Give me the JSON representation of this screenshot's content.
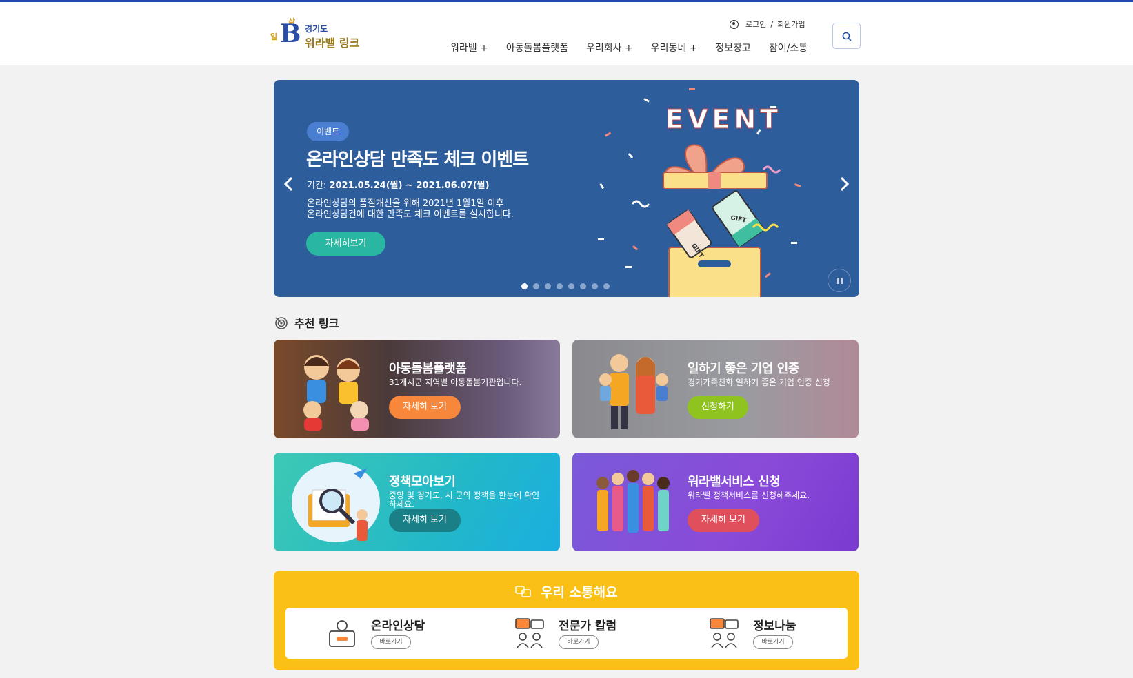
{
  "header": {
    "logo": {
      "region": "경기도",
      "name": "워라밸 링크",
      "mark_top": "삶",
      "mark_side": "일"
    },
    "util": {
      "login": "로그인",
      "separator": "/",
      "signup": "회원가입"
    },
    "nav": [
      "워라밸 +",
      "아동돌봄플랫폼",
      "우리회사 +",
      "우리동네 +",
      "정보창고",
      "참여/소통"
    ]
  },
  "banner": {
    "tag": "이벤트",
    "title": "온라인상담 만족도 체크 이벤트",
    "period_label": "기간:",
    "period": "2021.05.24(월) ~ 2021.06.07(월)",
    "desc_line1": "온라인상담의 품질개선을 위해 2021년 1월1일 이후",
    "desc_line2": "온라인상담건에 대한 만족도 체크 이벤트를 실시합니다.",
    "button": "자세히보기",
    "event_text": "EVENT",
    "gift": "GIFT",
    "slide_count": 8,
    "active_slide": 1
  },
  "recommend": {
    "title": "추천 링크",
    "cards": [
      {
        "title": "아동돌봄플랫폼",
        "desc": "31개시군 지역별 아동돌봄기관입니다.",
        "button": "자세히 보기",
        "button_color": "#f7873a"
      },
      {
        "title": "일하기 좋은 기업 인증",
        "desc": "경기가족친화 일하기 좋은 기업 인증 신청",
        "button": "신청하기",
        "button_color": "#8fc31f"
      },
      {
        "title": "정책모아보기",
        "desc": "중앙 및 경기도, 시 군의 정책을 한눈에 확인하세요.",
        "button": "자세히 보기",
        "button_color": "#1a7f86"
      },
      {
        "title": "워라밸서비스 신청",
        "desc": "워라밸 정책서비스를 신청해주세요.",
        "button": "자세히 보기",
        "button_color": "#e0505c"
      }
    ]
  },
  "communication": {
    "title": "우리 소통해요",
    "items": [
      {
        "label": "온라인상담",
        "button": "바로가기"
      },
      {
        "label": "전문가 칼럼",
        "button": "바로가기"
      },
      {
        "label": "정보나눔",
        "button": "바로가기"
      }
    ]
  }
}
